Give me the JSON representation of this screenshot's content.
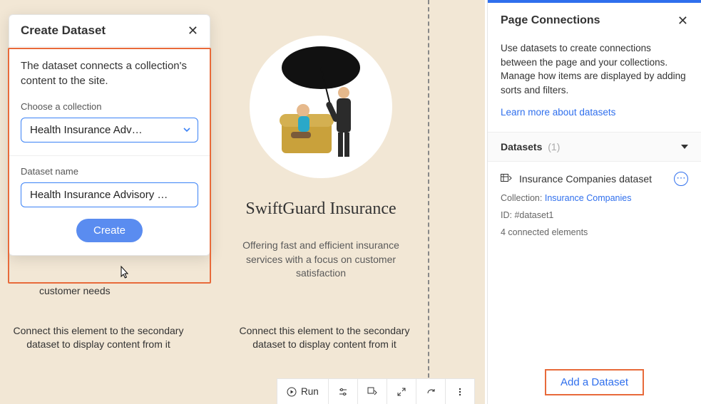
{
  "modal": {
    "title": "Create Dataset",
    "subtext": "The dataset connects a collection's content to the site.",
    "collection_label": "Choose a collection",
    "collection_value": "Health Insurance Adv…",
    "name_label": "Dataset name",
    "name_value": "Health Insurance Advisory …",
    "create_label": "Create"
  },
  "canvas": {
    "company_name": "SwiftGuard Insurance",
    "company_desc": "Offering fast and efficient insurance services with a focus on customer satisfaction",
    "left_name_fragment": "customer needs",
    "connect_msg": "Connect this element to the secondary dataset to display content from it"
  },
  "panel": {
    "title": "Page Connections",
    "desc": "Use datasets to create connections between the page and your collections. Manage how items are displayed by adding sorts and filters.",
    "learn_link": "Learn more about datasets",
    "section_title": "Datasets",
    "section_count": "(1)",
    "dataset": {
      "name": "Insurance Companies dataset",
      "collection_label": "Collection:",
      "collection_link": "Insurance Companies",
      "id_label": "ID:",
      "id_value": "#dataset1",
      "connected": "4 connected elements"
    },
    "add_label": "Add a Dataset"
  },
  "toolbar": {
    "run": "Run"
  }
}
